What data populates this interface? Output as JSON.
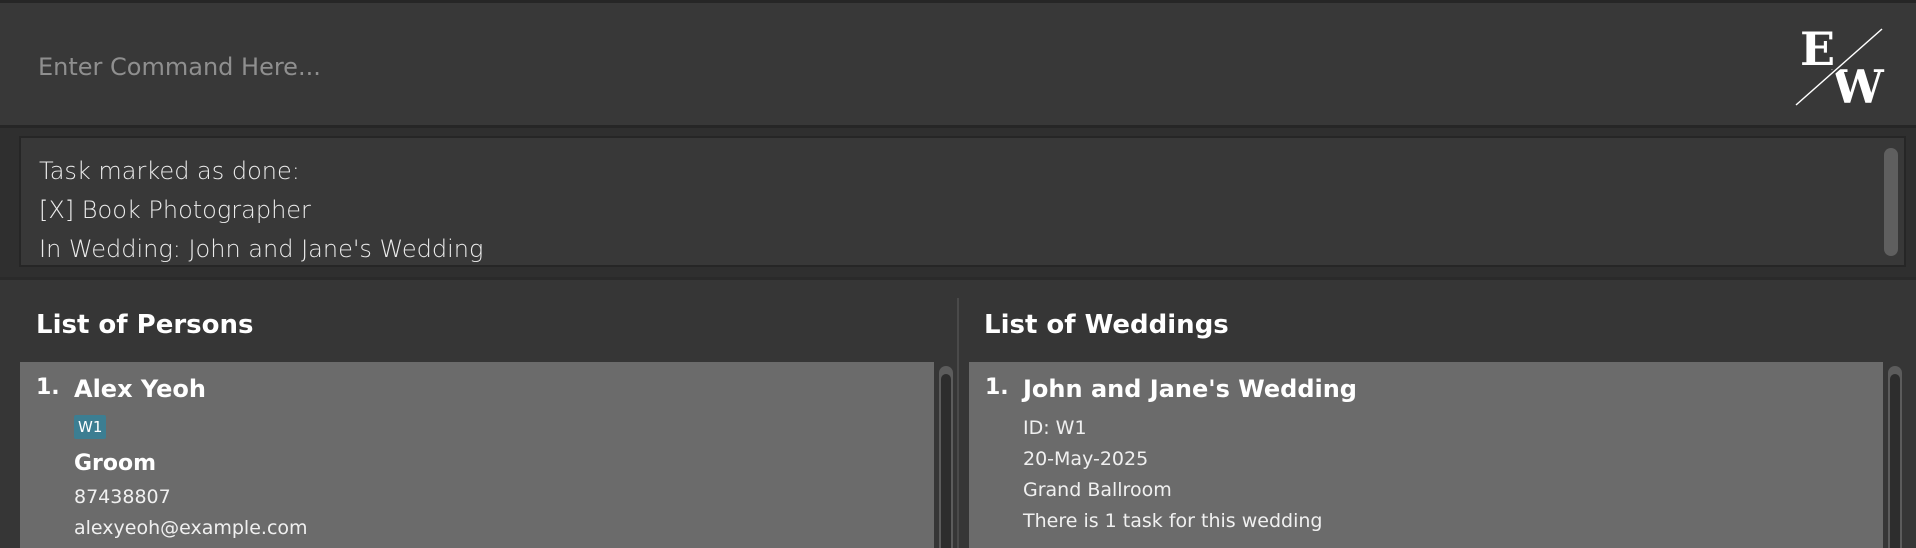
{
  "command": {
    "placeholder": "Enter Command Here...",
    "value": ""
  },
  "logo": {
    "icon": "ew-logo-icon",
    "text_left": "E",
    "text_right": "W"
  },
  "result": {
    "lines": [
      "Task marked as done:",
      "[X] Book Photographer",
      "In Wedding: John and Jane's Wedding"
    ]
  },
  "persons": {
    "title": "List of Persons",
    "items": [
      {
        "index": "1.",
        "name": "Alex Yeoh",
        "tag": "W1",
        "role": "Groom",
        "phone": "87438807",
        "email": "alexyeoh@example.com"
      }
    ]
  },
  "weddings": {
    "title": "List of Weddings",
    "items": [
      {
        "index": "1.",
        "name": "John and Jane's Wedding",
        "id": "ID: W1",
        "date": "20-May-2025",
        "venue": "Grand Ballroom",
        "tasks": "There is 1 task for this wedding"
      }
    ]
  },
  "colors": {
    "background": "#2f2f2f",
    "panel": "#383838",
    "card": "#6b6b6b",
    "tag": "#3c7e92"
  }
}
